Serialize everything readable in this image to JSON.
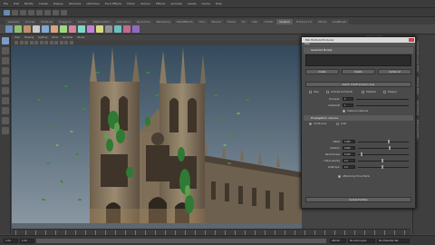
{
  "menubar": {
    "items": [
      "File",
      "Edit",
      "Modify",
      "Create",
      "Display",
      "Windows",
      "nParticles",
      "Fluid Effects",
      "Fields",
      "nSolver",
      "Effects",
      "Animate",
      "Assets",
      "Cache",
      "Help"
    ]
  },
  "shelf": {
    "tabs": [
      "General",
      "Curves",
      "Surfaces",
      "Polygons",
      "Subdiv",
      "Deformation",
      "Animation",
      "Dynamics",
      "Rendering",
      "PaintEffects",
      "Toon",
      "Muscle",
      "Fluids",
      "Fur",
      "Hair",
      "nCloth",
      "Custom",
      "Fracture FX",
      "XTools",
      "GoZBrush"
    ],
    "selected_index": 16,
    "icon_colors": [
      "#6b8fbf",
      "#8fbf6b",
      "#bf8f6b",
      "#c9c9c9",
      "#7fa8d9",
      "#d9a37f",
      "#9fd97f",
      "#d97f9f",
      "#7fd9c9",
      "#c97fd9",
      "#d9d97f",
      "#8f8f8f",
      "#6bbfbf",
      "#bf6b8f",
      "#8f6bbf"
    ]
  },
  "viewport": {
    "menu": [
      "View",
      "Shading",
      "Lighting",
      "Show",
      "Renderer",
      "Panels"
    ],
    "sky_top": "#344a5c",
    "sky_bottom": "#8c99a4",
    "stone": "#8a7a62",
    "stone_dark": "#5d5040",
    "leaf": "#2f7a34",
    "leaf_light": "#5aa24a"
  },
  "outer_panel": {
    "title": "Attribute Editor"
  },
  "right_tabs": [
    "Channel Box / Layer Editor",
    "Attribute Editor",
    "Tool Settings",
    "Modeling Toolkit"
  ],
  "dialog": {
    "title": "Pak Particle Producer",
    "menu": "Help",
    "section1": "Selected Nodes",
    "buttons_row1": [
      "Create",
      "Delete",
      "Update All"
    ],
    "button_sync": "Switch On/Off emission area",
    "check_label_1": "Stop",
    "check_label_2": "Activate at frame#",
    "check_label_3": "Disabled",
    "check_label_4": "Stopper",
    "field_nodal_lbl": "Occlusion",
    "field_nodal_val": "5",
    "field_cluster_lbl": "Cluster/nP",
    "field_cluster_val": "1",
    "check_instance": "Instance Instances",
    "section2": "Propagation volume",
    "radio_1": "Continuous",
    "radio_2": "Limit",
    "rows": [
      {
        "label": "Offset",
        "value": "1.000"
      },
      {
        "label": "Rotation",
        "value": "0.000"
      },
      {
        "label": "Randomness",
        "value": "0.100"
      },
      {
        "label": "Initial velocity",
        "value": "1.0"
      },
      {
        "label": "Initial Spin",
        "value": "1.0"
      }
    ],
    "check_affected": "Affected by Force Fields",
    "button_update": "Update Emitters"
  },
  "timeline": {
    "start": "1.00",
    "end": "200.00",
    "anim_layer": "No Anim Layer",
    "char_set": "No Character Set",
    "current": "1.00"
  }
}
